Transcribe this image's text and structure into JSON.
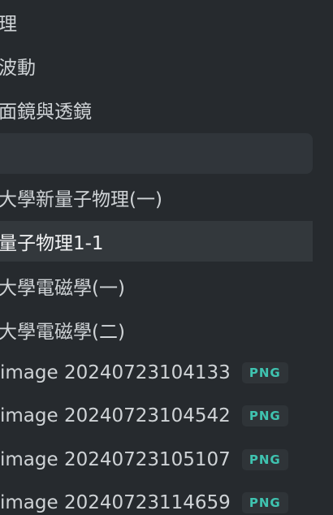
{
  "file_tree": {
    "items": [
      {
        "label": "理"
      },
      {
        "label": "波動"
      },
      {
        "label": "面鏡與透鏡"
      },
      {
        "label": ""
      },
      {
        "label": "大學新量子物理(一)"
      },
      {
        "label": "量子物理1-1"
      },
      {
        "label": "大學電磁學(一)"
      },
      {
        "label": "大學電磁學(二)"
      },
      {
        "label": "image 20240723104133",
        "badge": "PNG"
      },
      {
        "label": "image 20240723104542",
        "badge": "PNG"
      },
      {
        "label": "image 20240723105107",
        "badge": "PNG"
      },
      {
        "label": "image 20240723114659",
        "badge": "PNG"
      }
    ]
  }
}
